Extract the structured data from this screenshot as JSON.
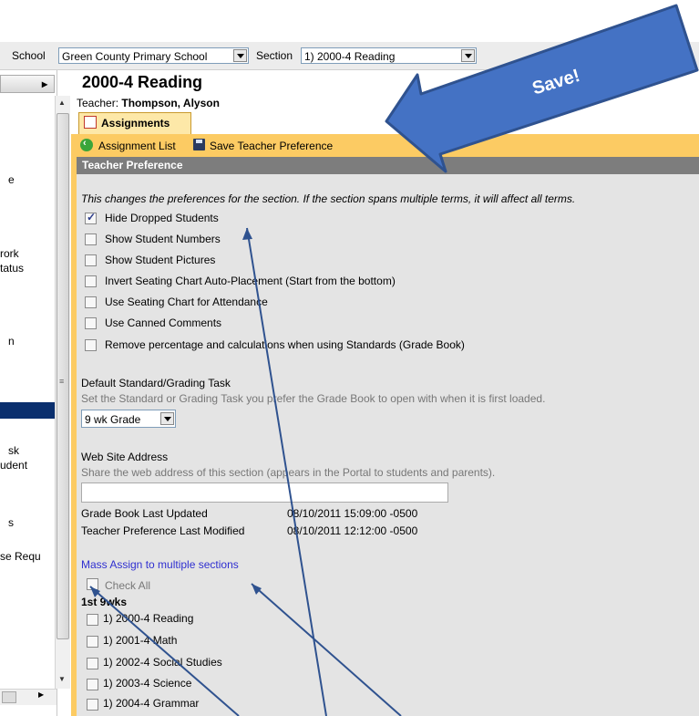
{
  "topbar": {
    "school_label": "School",
    "school_value": "Green County Primary School",
    "section_label": "Section",
    "section_value": "1) 2000-4 Reading"
  },
  "sidebar": {
    "items": [
      "e",
      "rork",
      "tatus",
      "n",
      "sk",
      "udent",
      "s",
      "se Requ"
    ]
  },
  "main": {
    "title": "2000-4 Reading",
    "teacher_label": "Teacher: ",
    "teacher_name": "Thompson, Alyson",
    "tab_label": "Assignments",
    "toolbar": {
      "assignment_list": "Assignment List",
      "save_pref": "Save Teacher Preference"
    },
    "section_header": "Teacher Preference",
    "note": "This changes the preferences for the section. If the section spans multiple terms, it will affect all terms.",
    "options": [
      {
        "label": "Hide Dropped Students",
        "checked": true
      },
      {
        "label": "Show Student Numbers",
        "checked": false
      },
      {
        "label": "Show Student Pictures",
        "checked": false
      },
      {
        "label": "Invert Seating Chart Auto-Placement (Start from the bottom)",
        "checked": false
      },
      {
        "label": "Use Seating Chart for Attendance",
        "checked": false
      },
      {
        "label": "Use Canned Comments",
        "checked": false
      },
      {
        "label": "Remove percentage and calculations when using Standards (Grade Book)",
        "checked": false
      }
    ],
    "default_task": {
      "label": "Default Standard/Grading Task",
      "help": "Set the Standard or Grading Task you prefer the Grade Book to open with when it is first loaded.",
      "value": "9 wk Grade"
    },
    "website": {
      "label": "Web Site Address",
      "help": "Share the web address of this section (appears in the Portal to students and parents).",
      "value": ""
    },
    "updated": {
      "gb_label": "Grade Book Last Updated",
      "gb_value": "08/10/2011 15:09:00 -0500",
      "tp_label": "Teacher Preference Last Modified",
      "tp_value": "08/10/2011 12:12:00 -0500"
    },
    "mass_assign": "Mass Assign to multiple sections",
    "check_all": "Check All",
    "term": "1st 9wks",
    "sections": [
      "1) 2000-4 Reading",
      "1) 2001-4 Math",
      "1) 2002-4 Social Studies",
      "1) 2003-4 Science",
      "1) 2004-4 Grammar"
    ]
  },
  "callout": {
    "text": "Save!",
    "color": "#4472c4",
    "border_color": "#2f528f"
  }
}
